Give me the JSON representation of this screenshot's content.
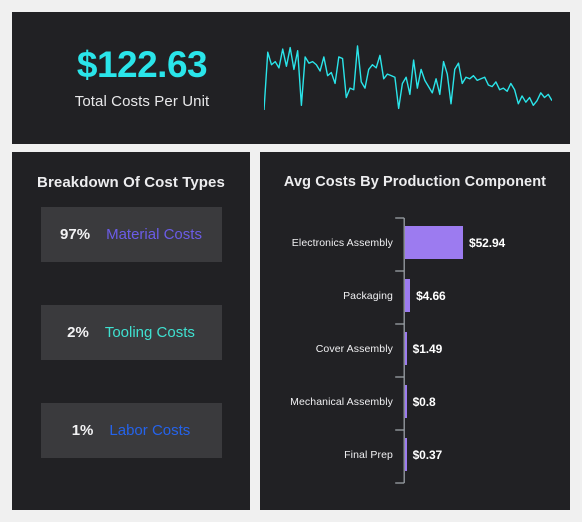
{
  "kpi": {
    "value": "$122.63",
    "label": "Total Costs Per Unit",
    "accent": "#2ae5ea",
    "sparkline": [
      18,
      92,
      76,
      80,
      72,
      96,
      74,
      98,
      70,
      94,
      24,
      86,
      78,
      80,
      76,
      68,
      86,
      62,
      66,
      52,
      86,
      84,
      34,
      46,
      44,
      100,
      54,
      46,
      70,
      76,
      72,
      88,
      58,
      64,
      62,
      60,
      20,
      52,
      60,
      38,
      82,
      46,
      70,
      56,
      48,
      40,
      58,
      38,
      80,
      64,
      26,
      70,
      78,
      52,
      60,
      58,
      62,
      56,
      58,
      60,
      50,
      48,
      54,
      44,
      46,
      42,
      52,
      44,
      26,
      36,
      28,
      34,
      24,
      30,
      40,
      34,
      38,
      30
    ]
  },
  "breakdown": {
    "title": "Breakdown Of Cost Types",
    "items": [
      {
        "pct": "97%",
        "name": "Material Costs",
        "color": "#6b5ce7"
      },
      {
        "pct": "2%",
        "name": "Tooling Costs",
        "color": "#3fe0d0"
      },
      {
        "pct": "1%",
        "name": "Labor Costs",
        "color": "#2563eb"
      }
    ]
  },
  "chart_data": {
    "type": "bar",
    "title": "Avg Costs By Production Component",
    "orientation": "horizontal",
    "bar_color": "#9c7bf0",
    "xlabel": "",
    "ylabel": "",
    "xlim": [
      0,
      52.94
    ],
    "grid": false,
    "legend": false,
    "categories": [
      "Electronics Assembly",
      "Packaging",
      "Cover Assembly",
      "Mechanical Assembly",
      "Final Prep"
    ],
    "values": [
      52.94,
      4.66,
      1.49,
      0.8,
      0.37
    ],
    "value_labels": [
      "$52.94",
      "$4.66",
      "$1.49",
      "$0.8",
      "$0.37"
    ]
  }
}
